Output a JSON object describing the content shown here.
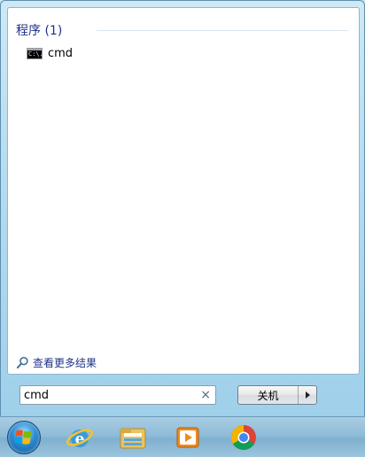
{
  "results": {
    "group_title": "程序 (1)",
    "items": [
      {
        "label": "cmd",
        "icon": "cmd-icon",
        "icon_text": "C:\\."
      }
    ],
    "see_more_label": "查看更多结果"
  },
  "search": {
    "value": "cmd",
    "clear_symbol": "×"
  },
  "shutdown": {
    "label": "关机"
  },
  "taskbar": {
    "items": [
      {
        "name": "start-orb",
        "icon": "windows-logo-icon"
      },
      {
        "name": "internet-explorer",
        "icon": "internet-explorer-icon"
      },
      {
        "name": "file-explorer",
        "icon": "folder-icon"
      },
      {
        "name": "media-player",
        "icon": "media-player-icon"
      },
      {
        "name": "chrome",
        "icon": "chrome-icon"
      }
    ]
  },
  "colors": {
    "link_blue": "#1e3287",
    "panel_border": "#8fb6cf",
    "taskbar": "#8fbcd8"
  }
}
